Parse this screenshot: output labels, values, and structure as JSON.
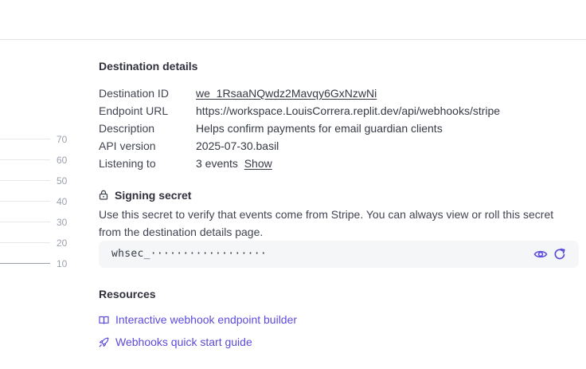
{
  "chart": {
    "ticks": [
      "70",
      "60",
      "50",
      "40",
      "30",
      "20",
      "10"
    ]
  },
  "destination": {
    "heading": "Destination details",
    "rows": [
      {
        "label": "Destination ID",
        "value": "we_1RsaaNQwdz2Mavqy6GxNzwNi"
      },
      {
        "label": "Endpoint URL",
        "value": "https://workspace.LouisCorrera.replit.dev/api/webhooks/stripe"
      },
      {
        "label": "Description",
        "value": "Helps confirm payments for email guardian clients"
      },
      {
        "label": "API version",
        "value": "2025-07-30.basil"
      },
      {
        "label": "Listening to",
        "value": "3 events",
        "link": "Show"
      }
    ]
  },
  "signing": {
    "heading": "Signing secret",
    "description": "Use this secret to verify that events come from Stripe. You can always view or roll this secret from the destination details page.",
    "secret_masked": "whsec_··················",
    "icons": [
      "eye-icon",
      "refresh-icon"
    ]
  },
  "resources": {
    "heading": "Resources",
    "links": [
      {
        "label": "Interactive webhook endpoint builder",
        "icon": "book-icon"
      },
      {
        "label": "Webhooks quick start guide",
        "icon": "rocket-icon"
      }
    ]
  },
  "colors": {
    "link": "#5b4bdb",
    "accent_icon": "#5b4bdb",
    "secret_bg": "#f5f6f8"
  }
}
